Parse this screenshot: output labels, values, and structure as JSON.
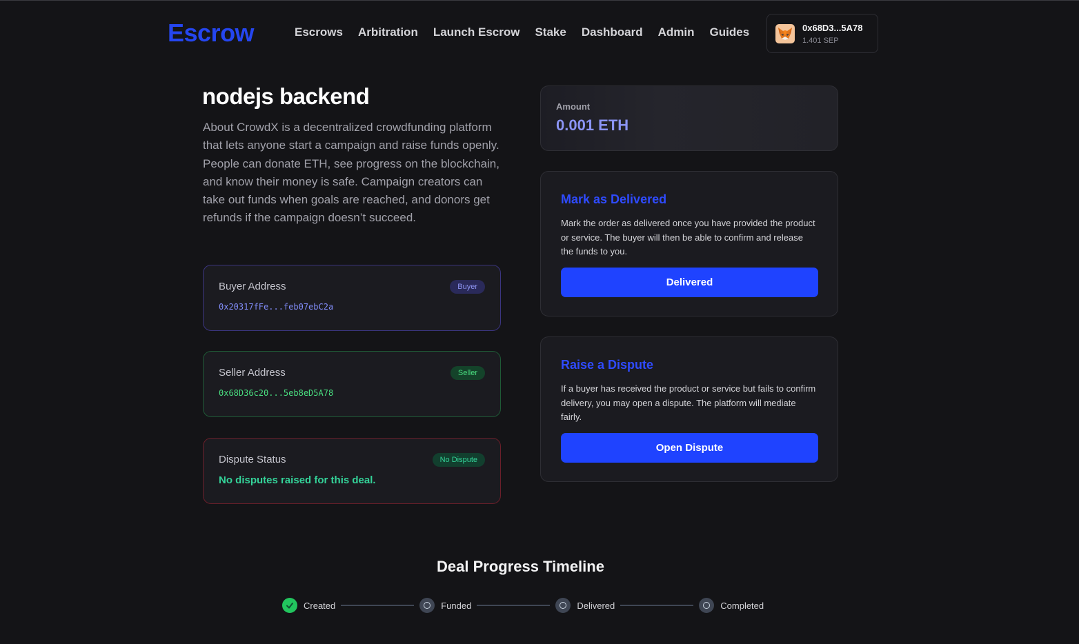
{
  "header": {
    "logo": "Escrow",
    "nav": [
      "Escrows",
      "Arbitration",
      "Launch Escrow",
      "Stake",
      "Dashboard",
      "Admin",
      "Guides"
    ],
    "wallet": {
      "address": "0x68D3...5A78",
      "balance": "1.401 SEP",
      "icon": "metamask-fox-icon"
    }
  },
  "escrow": {
    "title": "nodejs backend",
    "description": "About CrowdX is a decentralized crowdfunding platform that lets anyone start a campaign and raise funds openly. People can donate ETH, see progress on the blockchain, and know their money is safe. Campaign creators can take out funds when goals are reached, and donors get refunds if the campaign doesn’t succeed."
  },
  "buyer": {
    "label": "Buyer Address",
    "badge": "Buyer",
    "address": "0x20317fFe...feb07ebC2a"
  },
  "seller": {
    "label": "Seller Address",
    "badge": "Seller",
    "address": "0x68D36c20...5eb8eD5A78"
  },
  "dispute": {
    "label": "Dispute Status",
    "badge": "No Dispute",
    "text": "No disputes raised for this deal."
  },
  "amount": {
    "label": "Amount",
    "value": "0.001 ETH"
  },
  "delivered_card": {
    "title": "Mark as Delivered",
    "description": "Mark the order as delivered once you have provided the product or service. The buyer will then be able to confirm and release the funds to you.",
    "button": "Delivered"
  },
  "dispute_card": {
    "title": "Raise a Dispute",
    "description": "If a buyer has received the product or service but fails to confirm delivery, you may open a dispute. The platform will mediate fairly.",
    "button": "Open Dispute"
  },
  "timeline": {
    "title": "Deal Progress Timeline",
    "steps": [
      {
        "label": "Created",
        "done": true
      },
      {
        "label": "Funded",
        "done": false
      },
      {
        "label": "Delivered",
        "done": false
      },
      {
        "label": "Completed",
        "done": false
      }
    ]
  },
  "colors": {
    "accent": "#1f43ff",
    "background": "#141417",
    "success": "#22c55e"
  }
}
